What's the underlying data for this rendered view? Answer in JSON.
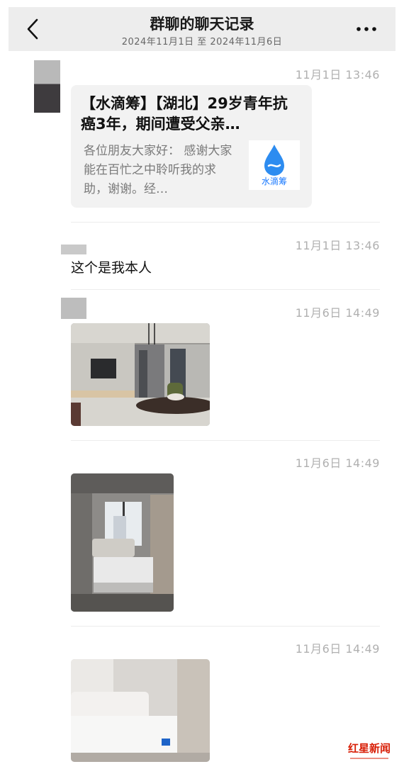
{
  "header": {
    "title": "群聊的聊天记录",
    "subtitle": "2024年11月1日 至 2024年11月6日"
  },
  "messages": [
    {
      "time": "11月1日 13:46",
      "type": "link-card",
      "card": {
        "title": "【水滴筹】【湖北】29岁青年抗癌3年，期间遭受父亲…",
        "description": "各位朋友大家好： 感谢大家能在百忙之中聆听我的求助，谢谢。经…",
        "logo_text": "水滴筹"
      }
    },
    {
      "time": "11月1日 13:46",
      "type": "text",
      "text": "这个是我本人"
    },
    {
      "time": "11月6日 14:49",
      "type": "image",
      "image_desc": "living-room photo"
    },
    {
      "time": "11月6日 14:49",
      "type": "image",
      "image_desc": "bedroom photo"
    },
    {
      "time": "11月6日 14:49",
      "type": "image",
      "image_desc": "bedroom with mattress photo"
    }
  ],
  "watermark": {
    "text": "红星新闻"
  },
  "colors": {
    "logo_blue": "#1677ff",
    "watermark_red": "#d81e06"
  }
}
